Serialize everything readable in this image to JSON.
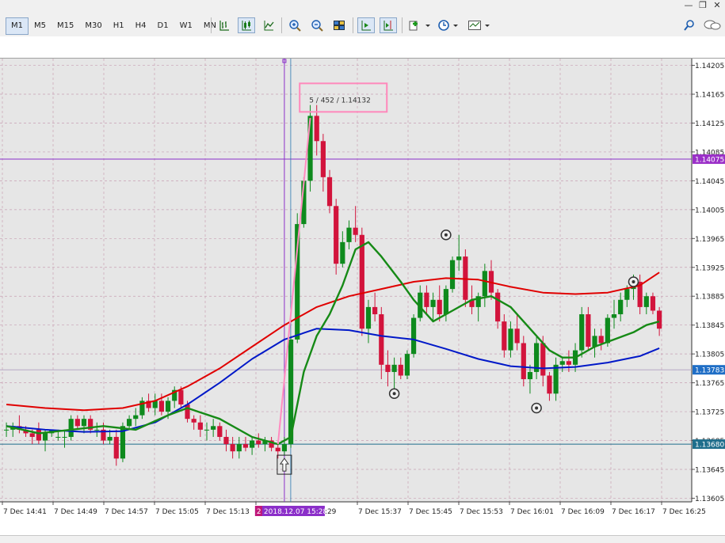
{
  "toolbar": {
    "timeframes": [
      {
        "label": "M1",
        "active": true
      },
      {
        "label": "M5",
        "active": false
      },
      {
        "label": "M15",
        "active": false
      },
      {
        "label": "M30",
        "active": false
      },
      {
        "label": "H1",
        "active": false
      },
      {
        "label": "H4",
        "active": false
      },
      {
        "label": "D1",
        "active": false
      },
      {
        "label": "W1",
        "active": false
      },
      {
        "label": "MN",
        "active": false
      }
    ],
    "icons": [
      "bar-chart-icon",
      "candlestick-chart-icon",
      "line-chart-icon",
      "zoom-in-icon",
      "zoom-out-icon",
      "tile-windows-icon",
      "autoscroll-icon",
      "chart-shift-icon",
      "indicators-icon",
      "periodicity-icon",
      "templates-icon"
    ]
  },
  "window_controls": [
    "minimize-icon",
    "restore-icon",
    "close-icon"
  ],
  "chart": {
    "price_labels": [
      "1.14205",
      "1.14165",
      "1.14125",
      "1.14085",
      "1.14045",
      "1.14005",
      "1.13965",
      "1.13925",
      "1.13885",
      "1.13845",
      "1.13805",
      "1.13765",
      "1.13725",
      "1.13685",
      "1.13645",
      "1.13605"
    ],
    "time_labels": [
      "7 Dec 14:41",
      "7 Dec 14:49",
      "7 Dec 14:57",
      "7 Dec 15:05",
      "7 Dec 15:13",
      "7",
      "7 Dec 15:37",
      "7 Dec 15:45",
      "7 Dec 15:53",
      "7 Dec 16:01",
      "7 Dec 16:09",
      "7 Dec 16:17",
      "7 Dec 16:25"
    ],
    "crosshair_time_label": "2018.12.07 15:28",
    "crosshair_badge": "2",
    "crosshair_time_suffix": ":29",
    "crosshair_price_tag": "1.14075",
    "bid_price_tag": "1.13783",
    "level_price_tag": "1.13680",
    "tooltip_text": "5 / 452 / 1.14132",
    "colors": {
      "background": "#e6e6e6",
      "grid": "#c8a0b4",
      "bull": "#0e8a1d",
      "bear": "#d2143c",
      "ma_red": "#e00000",
      "ma_blue": "#0018c8",
      "ma_green": "#168a16",
      "crosshair": "#8b2fc9",
      "tooltip_border": "#ff88bb",
      "price_tag_purple": "#9b30c8",
      "price_tag_blue": "#1f6ec6",
      "level_line": "#1f6e8c"
    }
  },
  "chart_data": {
    "type": "candlestick",
    "title": "",
    "xlabel": "",
    "ylabel": "",
    "ylim": [
      1.136,
      1.1421
    ],
    "candles": [
      [
        1.137,
        1.1371,
        1.1369,
        1.137
      ],
      [
        1.137,
        1.1371,
        1.1369,
        1.13705
      ],
      [
        1.13705,
        1.1372,
        1.13695,
        1.137
      ],
      [
        1.137,
        1.13705,
        1.1369,
        1.13695
      ],
      [
        1.13695,
        1.137,
        1.1368,
        1.1369
      ],
      [
        1.137,
        1.1371,
        1.1368,
        1.13685
      ],
      [
        1.13685,
        1.137,
        1.1367,
        1.13695
      ],
      [
        1.13695,
        1.137,
        1.1369,
        1.137
      ],
      [
        1.1369,
        1.137,
        1.13685,
        1.1369
      ],
      [
        1.1369,
        1.137,
        1.13675,
        1.1369
      ],
      [
        1.1369,
        1.1372,
        1.13685,
        1.13715
      ],
      [
        1.13715,
        1.1372,
        1.137,
        1.13705
      ],
      [
        1.13705,
        1.1372,
        1.13695,
        1.13715
      ],
      [
        1.13715,
        1.1372,
        1.13695,
        1.137
      ],
      [
        1.137,
        1.1371,
        1.1369,
        1.137
      ],
      [
        1.137,
        1.1371,
        1.1368,
        1.13685
      ],
      [
        1.13685,
        1.137,
        1.1368,
        1.1369
      ],
      [
        1.1369,
        1.137,
        1.1365,
        1.1366
      ],
      [
        1.1366,
        1.1371,
        1.13655,
        1.13705
      ],
      [
        1.13705,
        1.1372,
        1.137,
        1.13715
      ],
      [
        1.13715,
        1.1373,
        1.13705,
        1.1372
      ],
      [
        1.1372,
        1.13745,
        1.13715,
        1.1374
      ],
      [
        1.1374,
        1.1375,
        1.13725,
        1.1373
      ],
      [
        1.1373,
        1.1375,
        1.1372,
        1.1374
      ],
      [
        1.1374,
        1.1375,
        1.1372,
        1.13725
      ],
      [
        1.13725,
        1.13745,
        1.13715,
        1.1374
      ],
      [
        1.1374,
        1.1376,
        1.1373,
        1.13755
      ],
      [
        1.13755,
        1.1376,
        1.1373,
        1.13735
      ],
      [
        1.13735,
        1.1374,
        1.1371,
        1.13715
      ],
      [
        1.13715,
        1.1372,
        1.137,
        1.1371
      ],
      [
        1.1371,
        1.1372,
        1.1369,
        1.137
      ],
      [
        1.137,
        1.1371,
        1.13685,
        1.137
      ],
      [
        1.137,
        1.13715,
        1.1369,
        1.13705
      ],
      [
        1.13705,
        1.1371,
        1.13685,
        1.1369
      ],
      [
        1.1369,
        1.137,
        1.1367,
        1.1368
      ],
      [
        1.1368,
        1.1369,
        1.1366,
        1.1367
      ],
      [
        1.1367,
        1.1369,
        1.1366,
        1.1368
      ],
      [
        1.1368,
        1.1369,
        1.1367,
        1.13675
      ],
      [
        1.13675,
        1.1369,
        1.13665,
        1.13685
      ],
      [
        1.13685,
        1.13695,
        1.13675,
        1.1368
      ],
      [
        1.1368,
        1.1369,
        1.1367,
        1.13685
      ],
      [
        1.13685,
        1.1369,
        1.1367,
        1.13675
      ],
      [
        1.13675,
        1.1368,
        1.1366,
        1.1367
      ],
      [
        1.1367,
        1.1369,
        1.13665,
        1.1368
      ],
      [
        1.1368,
        1.1383,
        1.13675,
        1.13825
      ],
      [
        1.13825,
        1.14,
        1.1382,
        1.13985
      ],
      [
        1.13985,
        1.1405,
        1.1398,
        1.14045
      ],
      [
        1.14045,
        1.1415,
        1.1403,
        1.14135
      ],
      [
        1.14135,
        1.1415,
        1.1408,
        1.141
      ],
      [
        1.141,
        1.1411,
        1.1403,
        1.1405
      ],
      [
        1.1405,
        1.1406,
        1.14,
        1.1401
      ],
      [
        1.1401,
        1.1402,
        1.13915,
        1.1393
      ],
      [
        1.1393,
        1.13975,
        1.13925,
        1.1396
      ],
      [
        1.1396,
        1.1399,
        1.1395,
        1.1398
      ],
      [
        1.1398,
        1.1401,
        1.1396,
        1.1397
      ],
      [
        1.1397,
        1.1398,
        1.1383,
        1.1384
      ],
      [
        1.1384,
        1.1388,
        1.1382,
        1.1387
      ],
      [
        1.1387,
        1.1389,
        1.1385,
        1.1386
      ],
      [
        1.1386,
        1.1387,
        1.1377,
        1.1379
      ],
      [
        1.1379,
        1.1381,
        1.1376,
        1.1378
      ],
      [
        1.1378,
        1.138,
        1.1375,
        1.1379
      ],
      [
        1.1379,
        1.138,
        1.1377,
        1.13775
      ],
      [
        1.13775,
        1.1381,
        1.1377,
        1.13805
      ],
      [
        1.13805,
        1.1386,
        1.138,
        1.13855
      ],
      [
        1.13855,
        1.139,
        1.1385,
        1.1389
      ],
      [
        1.1389,
        1.139,
        1.1386,
        1.1387
      ],
      [
        1.1387,
        1.1389,
        1.1385,
        1.1388
      ],
      [
        1.1388,
        1.139,
        1.1385,
        1.1386
      ],
      [
        1.1386,
        1.139,
        1.1385,
        1.13895
      ],
      [
        1.13895,
        1.1394,
        1.1389,
        1.13935
      ],
      [
        1.13935,
        1.1397,
        1.1392,
        1.1394
      ],
      [
        1.1394,
        1.1395,
        1.1387,
        1.1388
      ],
      [
        1.1388,
        1.139,
        1.1386,
        1.1387
      ],
      [
        1.1387,
        1.1389,
        1.1385,
        1.13885
      ],
      [
        1.13885,
        1.1393,
        1.1387,
        1.1392
      ],
      [
        1.1392,
        1.13935,
        1.1388,
        1.1389
      ],
      [
        1.1389,
        1.13895,
        1.1384,
        1.1385
      ],
      [
        1.1385,
        1.1386,
        1.138,
        1.1381
      ],
      [
        1.1381,
        1.1385,
        1.138,
        1.1384
      ],
      [
        1.1384,
        1.1386,
        1.1381,
        1.1382
      ],
      [
        1.1382,
        1.1383,
        1.1376,
        1.1377
      ],
      [
        1.1377,
        1.1379,
        1.1375,
        1.1378
      ],
      [
        1.1378,
        1.1383,
        1.1377,
        1.1382
      ],
      [
        1.1382,
        1.1383,
        1.1376,
        1.13775
      ],
      [
        1.13775,
        1.1378,
        1.1374,
        1.1375
      ],
      [
        1.1375,
        1.138,
        1.1374,
        1.1379
      ],
      [
        1.1379,
        1.138,
        1.1378,
        1.13795
      ],
      [
        1.13795,
        1.1381,
        1.1378,
        1.1379
      ],
      [
        1.1379,
        1.1382,
        1.1378,
        1.1381
      ],
      [
        1.1381,
        1.1387,
        1.138,
        1.1386
      ],
      [
        1.1386,
        1.1387,
        1.1381,
        1.13815
      ],
      [
        1.13815,
        1.1384,
        1.138,
        1.1383
      ],
      [
        1.1383,
        1.1384,
        1.1381,
        1.1382
      ],
      [
        1.1382,
        1.1386,
        1.13815,
        1.13855
      ],
      [
        1.13855,
        1.1388,
        1.1384,
        1.1386
      ],
      [
        1.1386,
        1.1389,
        1.1385,
        1.1388
      ],
      [
        1.1388,
        1.139,
        1.1387,
        1.13895
      ],
      [
        1.13895,
        1.13915,
        1.1388,
        1.13905
      ],
      [
        1.13905,
        1.13915,
        1.1386,
        1.1387
      ],
      [
        1.1387,
        1.1389,
        1.1386,
        1.13885
      ],
      [
        1.13885,
        1.1389,
        1.1386,
        1.13865
      ],
      [
        1.13865,
        1.1387,
        1.1383,
        1.1384
      ]
    ],
    "ma_red": [
      [
        0,
        1.13735
      ],
      [
        6,
        1.1373
      ],
      [
        12,
        1.13727
      ],
      [
        18,
        1.1373
      ],
      [
        23,
        1.1374
      ],
      [
        28,
        1.1376
      ],
      [
        33,
        1.13785
      ],
      [
        38,
        1.13815
      ],
      [
        43,
        1.13845
      ],
      [
        48,
        1.1387
      ],
      [
        53,
        1.13885
      ],
      [
        58,
        1.13895
      ],
      [
        63,
        1.13905
      ],
      [
        68,
        1.1391
      ],
      [
        73,
        1.13908
      ],
      [
        78,
        1.13898
      ],
      [
        83,
        1.1389
      ],
      [
        88,
        1.13888
      ],
      [
        93,
        1.1389
      ],
      [
        98,
        1.139
      ],
      [
        101,
        1.13918
      ]
    ],
    "ma_blue": [
      [
        0,
        1.13705
      ],
      [
        6,
        1.137
      ],
      [
        12,
        1.13697
      ],
      [
        18,
        1.13698
      ],
      [
        23,
        1.1371
      ],
      [
        28,
        1.13735
      ],
      [
        33,
        1.13765
      ],
      [
        38,
        1.13798
      ],
      [
        43,
        1.13825
      ],
      [
        48,
        1.1384
      ],
      [
        53,
        1.13838
      ],
      [
        58,
        1.1383
      ],
      [
        63,
        1.13825
      ],
      [
        68,
        1.13812
      ],
      [
        73,
        1.13798
      ],
      [
        78,
        1.13788
      ],
      [
        83,
        1.13785
      ],
      [
        88,
        1.13787
      ],
      [
        93,
        1.13793
      ],
      [
        98,
        1.13802
      ],
      [
        101,
        1.13813
      ]
    ],
    "ma_green": [
      [
        0,
        1.13705
      ],
      [
        5,
        1.13695
      ],
      [
        10,
        1.137
      ],
      [
        15,
        1.13705
      ],
      [
        20,
        1.137
      ],
      [
        25,
        1.1372
      ],
      [
        28,
        1.1373
      ],
      [
        33,
        1.13715
      ],
      [
        38,
        1.1369
      ],
      [
        42,
        1.1368
      ],
      [
        44,
        1.1369
      ],
      [
        46,
        1.1378
      ],
      [
        48,
        1.1383
      ],
      [
        50,
        1.1386
      ],
      [
        52,
        1.139
      ],
      [
        54,
        1.1395
      ],
      [
        56,
        1.1396
      ],
      [
        58,
        1.1394
      ],
      [
        61,
        1.13905
      ],
      [
        63,
        1.1388
      ],
      [
        66,
        1.1385
      ],
      [
        69,
        1.13865
      ],
      [
        72,
        1.1388
      ],
      [
        75,
        1.13885
      ],
      [
        78,
        1.1387
      ],
      [
        81,
        1.1384
      ],
      [
        84,
        1.1381
      ],
      [
        86,
        1.138
      ],
      [
        88,
        1.138
      ],
      [
        91,
        1.13815
      ],
      [
        94,
        1.13825
      ],
      [
        97,
        1.13835
      ],
      [
        99,
        1.13845
      ],
      [
        101,
        1.1385
      ]
    ],
    "pink_line": [
      [
        42,
        1.1368
      ],
      [
        47,
        1.14132
      ]
    ],
    "fractal_markers": [
      [
        68,
        1.1397
      ],
      [
        60,
        1.1375
      ],
      [
        82,
        1.1373
      ],
      [
        97,
        1.13905
      ]
    ],
    "horizontal_levels": [
      1.14075,
      1.13783,
      1.1368
    ],
    "crosshair_index": 43
  }
}
